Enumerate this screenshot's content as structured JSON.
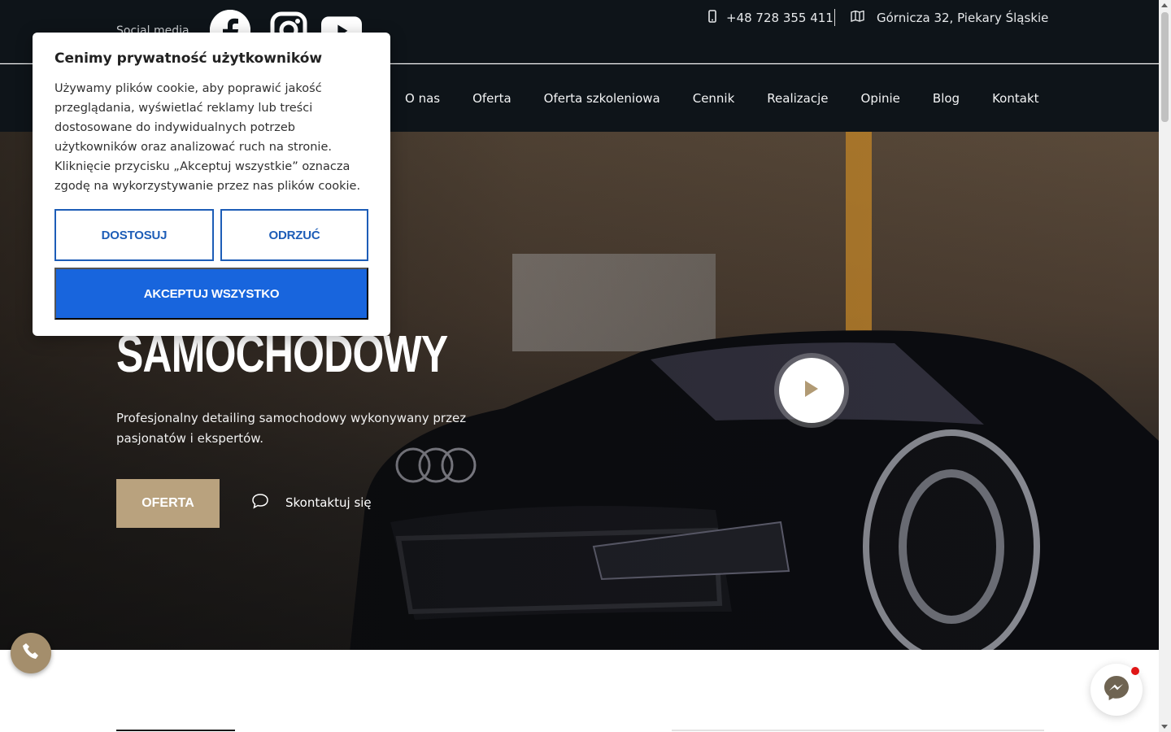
{
  "topbar": {
    "social_label": "Social media",
    "social": [
      {
        "icon": "facebook-icon"
      },
      {
        "icon": "instagram-icon"
      },
      {
        "icon": "youtube-icon"
      }
    ],
    "phone": "+48 728 355 411",
    "address": "Górnicza 32, Piekary Śląskie"
  },
  "nav": {
    "items": [
      "O nas",
      "Oferta",
      "Oferta szkoleniowa",
      "Cennik",
      "Realizacje",
      "Opinie",
      "Blog",
      "Kontakt"
    ]
  },
  "hero": {
    "title": "SAMOCHODOWY",
    "subtitle": "Profesjonalny detailing samochodowy wykonywany przez pasjonatów i ekspertów.",
    "cta_label": "OFERTA",
    "contact_label": "Skontaktuj się"
  },
  "cookie": {
    "title": "Cenimy prywatność użytkowników",
    "text": "Używamy plików cookie, aby poprawić jakość przeglądania, wyświetlać reklamy lub treści dostosowane do indywidualnych potrzeb użytkowników oraz analizować ruch na stronie. Kliknięcie przycisku „Akceptuj wszystkie” oznacza zgodę na wykorzystywanie przez nas plików cookie.",
    "customize_label": "DOSTOSUJ",
    "reject_label": "ODRZUĆ",
    "accept_label": "AKCEPTUJ WSZYSTKO"
  },
  "colors": {
    "dark": "#0e1419",
    "accent_gold": "#b9a27e",
    "cookie_blue": "#1865dd",
    "notification_red": "#e01616"
  }
}
